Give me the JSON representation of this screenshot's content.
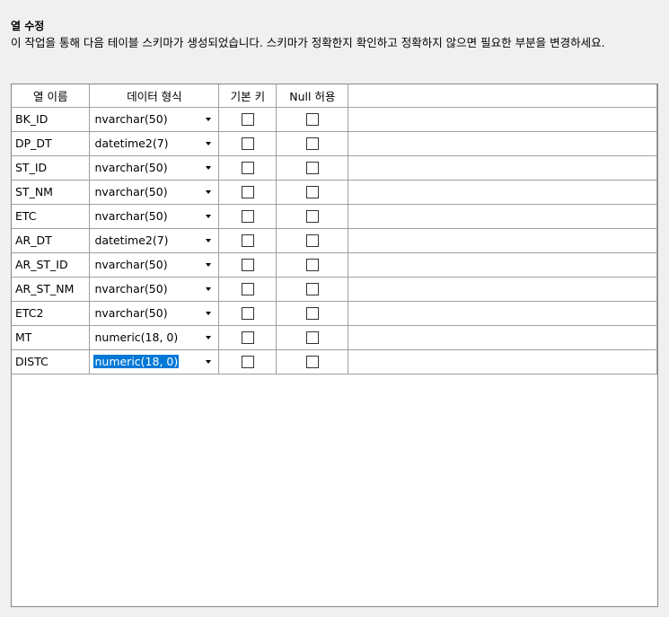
{
  "header": {
    "title": "열 수정",
    "description": "이 작업을 통해 다음 테이블 스키마가 생성되었습니다. 스키마가 정확한지 확인하고 정확하지 않으면 필요한 부분을 변경하세요."
  },
  "table": {
    "columns": [
      "열 이름",
      "데이터 형식",
      "기본 키",
      "Null 허용"
    ],
    "rows": [
      {
        "name": "BK_ID",
        "type": "nvarchar(50)",
        "primary_key": false,
        "nullable": false
      },
      {
        "name": "DP_DT",
        "type": "datetime2(7)",
        "primary_key": false,
        "nullable": false
      },
      {
        "name": "ST_ID",
        "type": "nvarchar(50)",
        "primary_key": false,
        "nullable": false
      },
      {
        "name": "ST_NM",
        "type": "nvarchar(50)",
        "primary_key": false,
        "nullable": false
      },
      {
        "name": "ETC",
        "type": "nvarchar(50)",
        "primary_key": false,
        "nullable": false
      },
      {
        "name": "AR_DT",
        "type": "datetime2(7)",
        "primary_key": false,
        "nullable": false
      },
      {
        "name": "AR_ST_ID",
        "type": "nvarchar(50)",
        "primary_key": false,
        "nullable": false
      },
      {
        "name": "AR_ST_NM",
        "type": "nvarchar(50)",
        "primary_key": false,
        "nullable": false
      },
      {
        "name": "ETC2",
        "type": "nvarchar(50)",
        "primary_key": false,
        "nullable": false
      },
      {
        "name": "MT",
        "type": "numeric(18, 0)",
        "primary_key": false,
        "nullable": false
      },
      {
        "name": "DISTC",
        "type": "numeric(18, 0)",
        "primary_key": false,
        "nullable": false,
        "selected": true
      }
    ]
  },
  "colors": {
    "selection": "#0078d7",
    "background": "#f0f0f0",
    "grid_line": "#a0a0a0"
  }
}
